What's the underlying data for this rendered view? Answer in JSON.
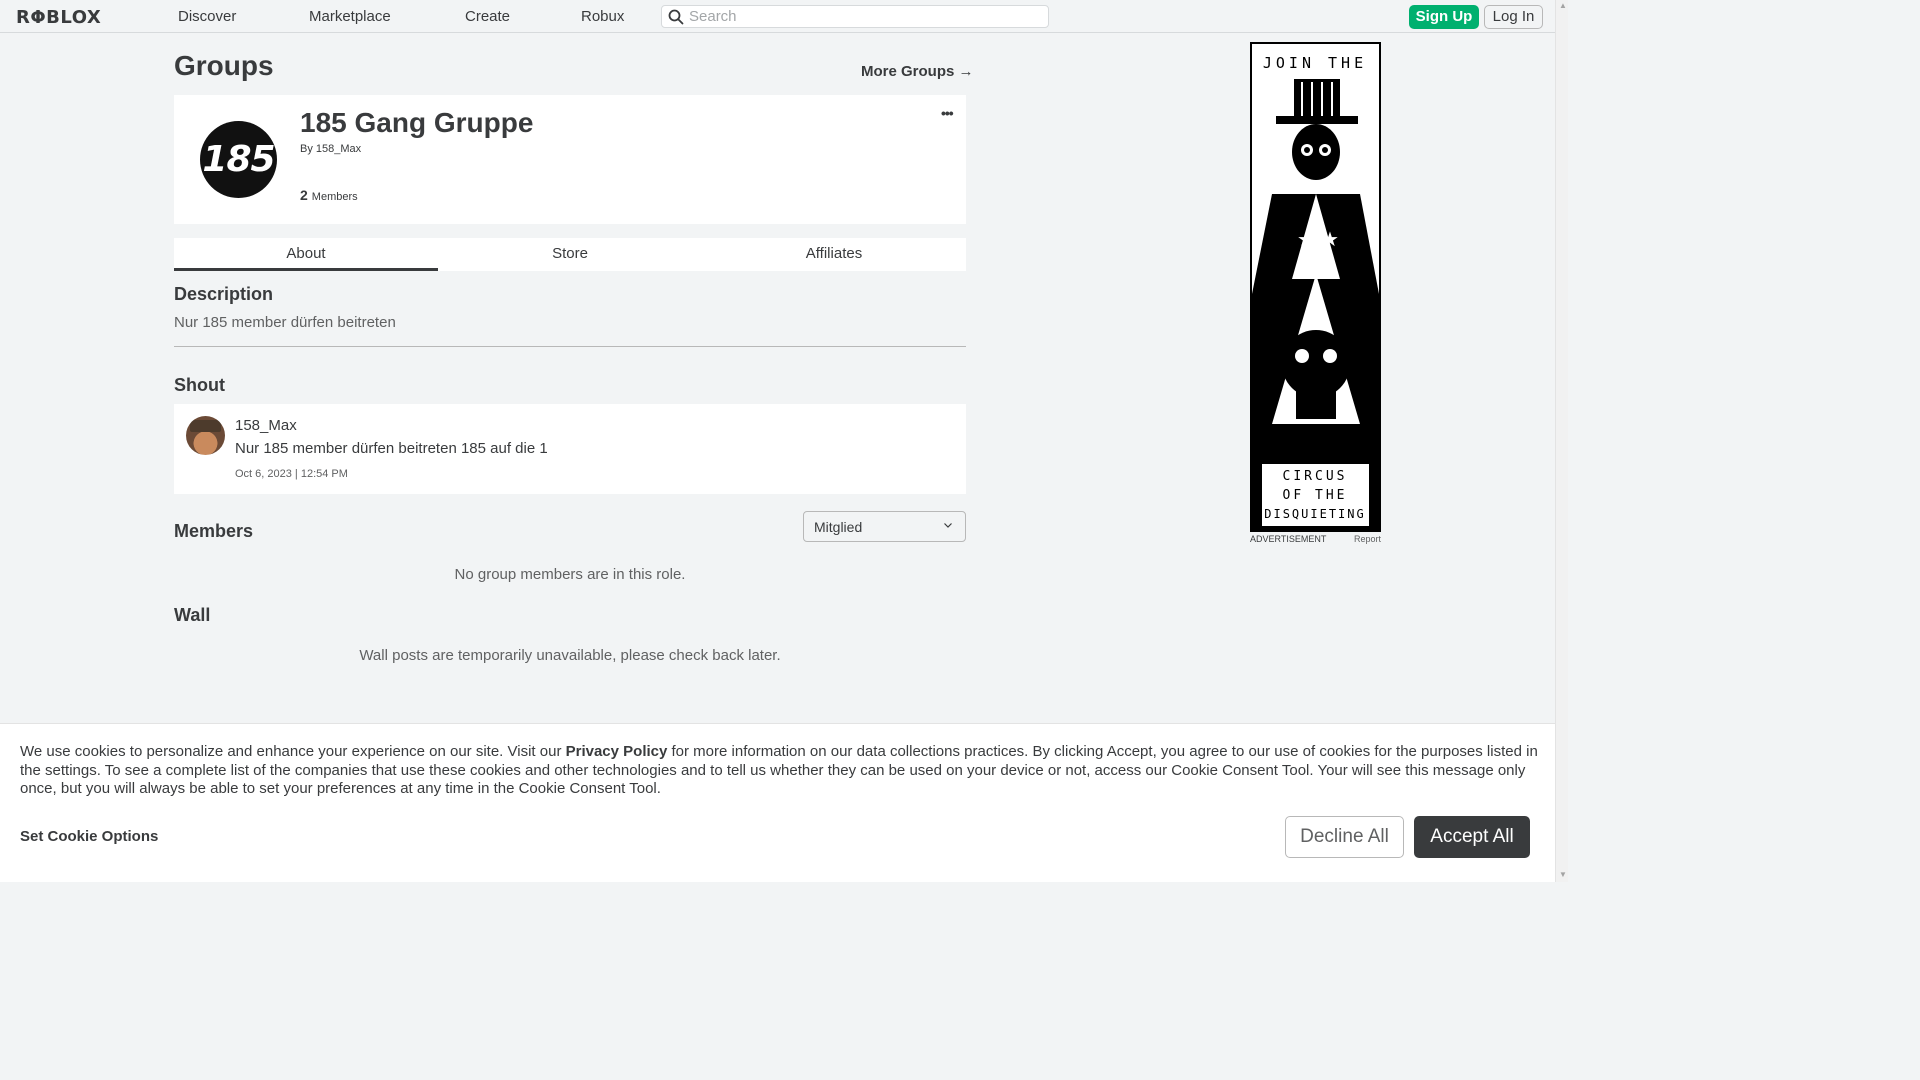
{
  "nav": {
    "logo": "RΦBLOX",
    "links": [
      "Discover",
      "Marketplace",
      "Create",
      "Robux"
    ],
    "search_placeholder": "Search",
    "signup": "Sign Up",
    "login": "Log In"
  },
  "page": {
    "title": "Groups",
    "more_groups": "More Groups →"
  },
  "group": {
    "emblem_text": "185",
    "name": "185 Gang Gruppe",
    "by_label": "By ",
    "owner": "158_Max",
    "member_count": "2",
    "members_label": "Members",
    "more_dots": "•••"
  },
  "tabs": [
    "About",
    "Store",
    "Affiliates"
  ],
  "description": {
    "title": "Description",
    "text": "Nur 185 member dürfen beitreten"
  },
  "shout": {
    "title": "Shout",
    "user": "158_Max",
    "body": "Nur 185 member dürfen beitreten 185 auf die 1",
    "date": "Oct 6, 2023 | 12:54 PM"
  },
  "members": {
    "title": "Members",
    "role_selected": "Mitglied",
    "empty": "No group members are in this role."
  },
  "wall": {
    "title": "Wall",
    "empty": "Wall posts are temporarily unavailable, please check back later."
  },
  "ad": {
    "top_text": "JOIN THE",
    "bottom_lines": [
      "CIRCUS",
      "OF THE",
      "DISQUIETING"
    ],
    "label": "ADVERTISEMENT",
    "report": "Report"
  },
  "cookie": {
    "text_before": "We use cookies to personalize and enhance your experience on our site. Visit our ",
    "privacy_link": "Privacy Policy",
    "text_after": " for more information on our data collections practices. By clicking Accept, you agree to our use of cookies for the purposes listed in the settings. To see a complete list of the companies that use these cookies and other technologies and to tell us whether they can be used on your device or not, access our Cookie Consent Tool. Your will see this message only once, but you will always be able to set your preferences at any time in the Cookie Consent Tool.",
    "options": "Set Cookie Options",
    "decline": "Decline All",
    "accept": "Accept All"
  },
  "colors": {
    "signup_green": "#00b06f",
    "accept_dark": "#393b3d",
    "page_bg": "#f2f4f5"
  }
}
